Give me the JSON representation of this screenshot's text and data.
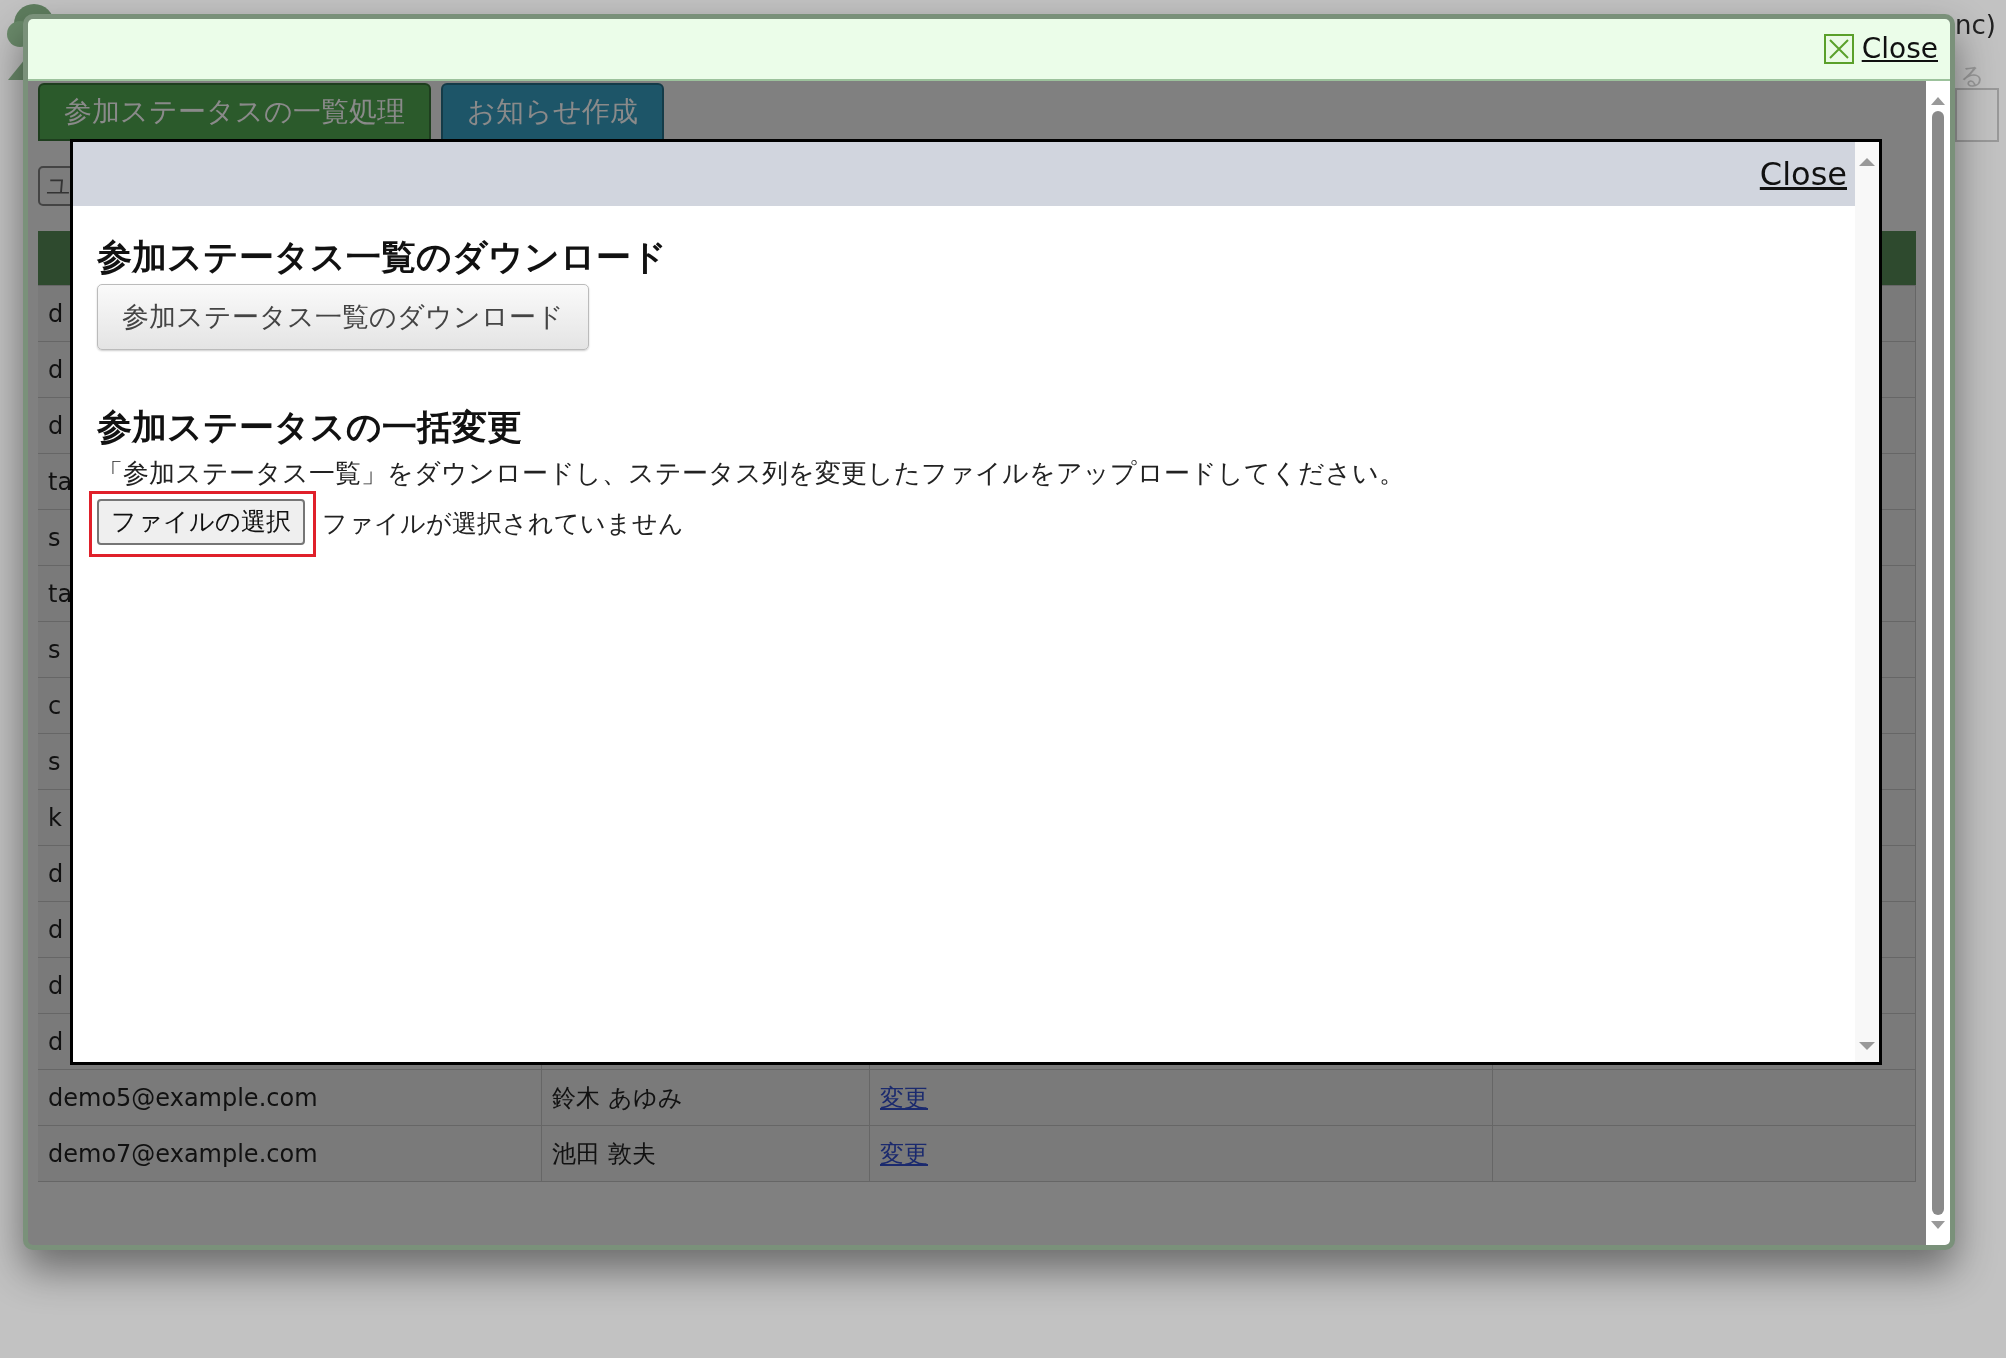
{
  "background": {
    "fragments": [
      "nc)",
      "る"
    ]
  },
  "dialog": {
    "close_label": "Close",
    "tabs": [
      {
        "label": "参加ステータスの一覧処理",
        "color": "#2b5a2b"
      },
      {
        "label": "お知らせ作成",
        "color": "#1d5568"
      }
    ],
    "search_field": {
      "value": "ユ"
    },
    "table": {
      "rows": [
        {
          "email": "d"
        },
        {
          "email": "d"
        },
        {
          "email": "d"
        },
        {
          "email": "ta"
        },
        {
          "email": "s"
        },
        {
          "email": "ta"
        },
        {
          "email": "s"
        },
        {
          "email": "c"
        },
        {
          "email": "s"
        },
        {
          "email": "k"
        },
        {
          "email": "d"
        },
        {
          "email": "d"
        },
        {
          "email": "d"
        },
        {
          "email": "d"
        },
        {
          "email": "demo5@example.com",
          "name": "鈴木 あゆみ",
          "action": "変更"
        },
        {
          "email": "demo7@example.com",
          "name": "池田 敦夫",
          "action": "変更"
        }
      ]
    }
  },
  "modal": {
    "close_label": "Close",
    "sections": [
      {
        "kind": "download",
        "heading": "参加ステータス一覧のダウンロード",
        "button": "参加ステータス一覧のダウンロード"
      },
      {
        "kind": "upload",
        "heading": "参加ステータスの一括変更",
        "text": "「参加ステータス一覧」をダウンロードし、ステータス列を変更したファイルをアップロードしてください。",
        "file_button": "ファイルの選択",
        "file_status": "ファイルが選択されていません",
        "highlighted": true
      }
    ]
  }
}
